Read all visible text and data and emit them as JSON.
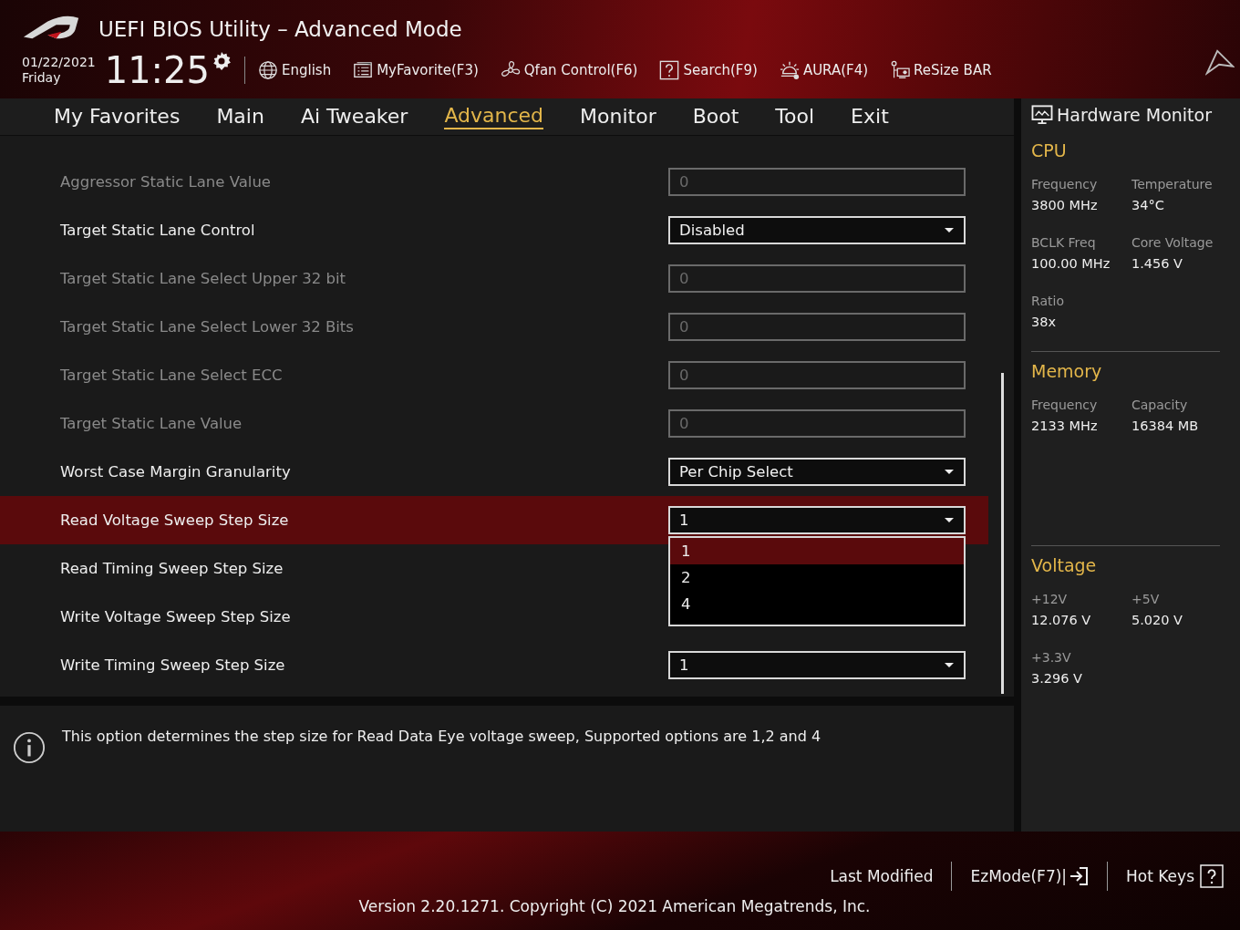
{
  "window": {
    "title": "UEFI BIOS Utility – Advanced Mode"
  },
  "clock": {
    "date": "01/22/2021",
    "day": "Friday",
    "time": "11:25"
  },
  "toolbar": [
    {
      "kind": "language",
      "label": "English"
    },
    {
      "kind": "favorite",
      "label": "MyFavorite(F3)"
    },
    {
      "kind": "fan",
      "label": "Qfan Control(F6)"
    },
    {
      "kind": "search",
      "label": "Search(F9)"
    },
    {
      "kind": "aura",
      "label": "AURA(F4)"
    },
    {
      "kind": "resize",
      "label": "ReSize BAR"
    }
  ],
  "tabs": [
    {
      "label": "My Favorites",
      "selected": false
    },
    {
      "label": "Main",
      "selected": false
    },
    {
      "label": "Ai Tweaker",
      "selected": false
    },
    {
      "label": "Advanced",
      "selected": true
    },
    {
      "label": "Monitor",
      "selected": false
    },
    {
      "label": "Boot",
      "selected": false
    },
    {
      "label": "Tool",
      "selected": false
    },
    {
      "label": "Exit",
      "selected": false
    }
  ],
  "settings": [
    {
      "label": "Aggressor Static Lane Value",
      "kind": "number",
      "disabled": true,
      "selected": false,
      "value": "0"
    },
    {
      "label": "Target Static Lane Control",
      "kind": "dropdown",
      "disabled": false,
      "selected": false,
      "value": "Disabled"
    },
    {
      "label": "Target Static Lane Select Upper 32 bit",
      "kind": "number",
      "disabled": true,
      "selected": false,
      "value": "0"
    },
    {
      "label": "Target Static Lane Select Lower 32 Bits",
      "kind": "number",
      "disabled": true,
      "selected": false,
      "value": "0"
    },
    {
      "label": "Target Static Lane Select ECC",
      "kind": "number",
      "disabled": true,
      "selected": false,
      "value": "0"
    },
    {
      "label": "Target Static Lane Value",
      "kind": "number",
      "disabled": true,
      "selected": false,
      "value": "0"
    },
    {
      "label": "Worst Case Margin Granularity",
      "kind": "dropdown",
      "disabled": false,
      "selected": false,
      "value": "Per Chip Select"
    },
    {
      "label": "Read Voltage Sweep Step Size",
      "kind": "dropdown",
      "disabled": false,
      "selected": true,
      "value": "1",
      "options": [
        {
          "label": "1",
          "selected": true
        },
        {
          "label": "2",
          "selected": false
        },
        {
          "label": "4",
          "selected": false
        }
      ]
    },
    {
      "label": "Read Timing Sweep Step Size",
      "kind": "hidden",
      "disabled": false,
      "selected": false
    },
    {
      "label": "Write Voltage Sweep Step Size",
      "kind": "hidden",
      "disabled": false,
      "selected": false
    },
    {
      "label": "Write Timing Sweep Step Size",
      "kind": "dropdown",
      "disabled": false,
      "selected": false,
      "value": "1"
    }
  ],
  "help": "This option determines the step size for Read Data Eye voltage sweep, Supported options are 1,2 and 4",
  "hardware_monitor": {
    "title": "Hardware Monitor",
    "sections": [
      {
        "title": "CPU",
        "items": [
          {
            "label": "Frequency",
            "value": "3800 MHz"
          },
          {
            "label": "Temperature",
            "value": "34°C"
          },
          {
            "label": "BCLK Freq",
            "value": "100.00 MHz"
          },
          {
            "label": "Core Voltage",
            "value": "1.456 V"
          },
          {
            "label": "Ratio",
            "value": "38x"
          }
        ]
      },
      {
        "title": "Memory",
        "items": [
          {
            "label": "Frequency",
            "value": "2133 MHz"
          },
          {
            "label": "Capacity",
            "value": "16384 MB"
          }
        ]
      },
      {
        "title": "Voltage",
        "items": [
          {
            "label": "+12V",
            "value": "12.076 V"
          },
          {
            "label": "+5V",
            "value": "5.020 V"
          },
          {
            "label": "+3.3V",
            "value": "3.296 V"
          }
        ]
      }
    ]
  },
  "footer": {
    "buttons": [
      {
        "kind": "last",
        "label": "Last Modified"
      },
      {
        "kind": "ezmode",
        "label": "EzMode(F7)|"
      },
      {
        "kind": "hotkeys",
        "label": "Hot Keys"
      }
    ],
    "version": "Version 2.20.1271. Copyright (C) 2021 American Megatrends, Inc."
  }
}
